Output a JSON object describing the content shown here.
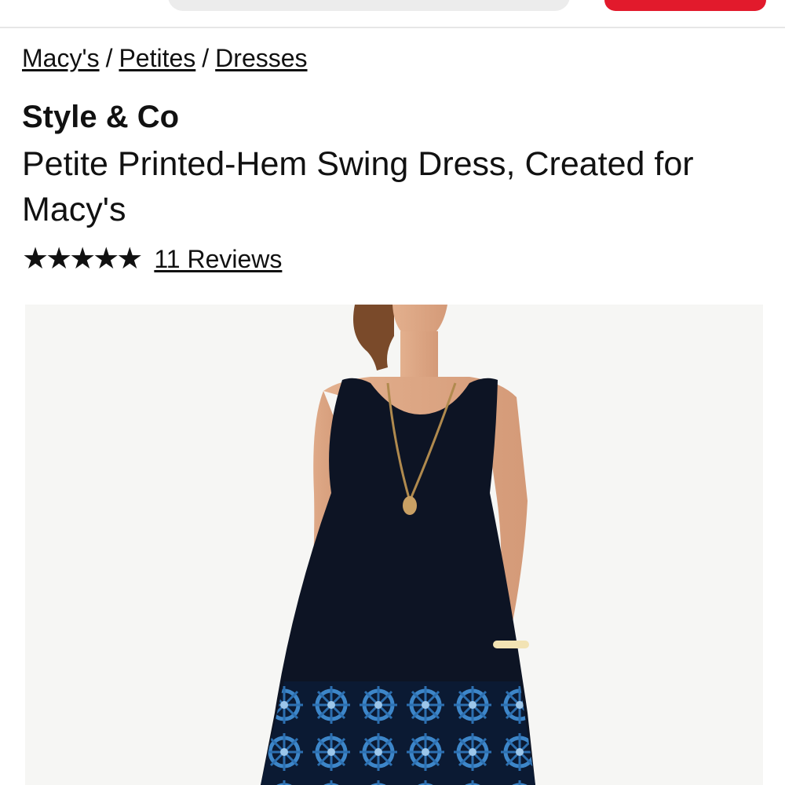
{
  "breadcrumb": {
    "items": [
      "Macy's",
      "Petites",
      "Dresses"
    ],
    "separator": "/"
  },
  "product": {
    "brand": "Style & Co",
    "name": "Petite Printed-Hem Swing Dress, Created for Macy's",
    "rating_stars": "★★★★★",
    "rating_value": 5,
    "rating_max": 5,
    "reviews_label": "11 Reviews"
  },
  "colors": {
    "brand_red": "#e21a2c",
    "dress": "#0d1424",
    "hem_print": "#2c6fb0"
  }
}
